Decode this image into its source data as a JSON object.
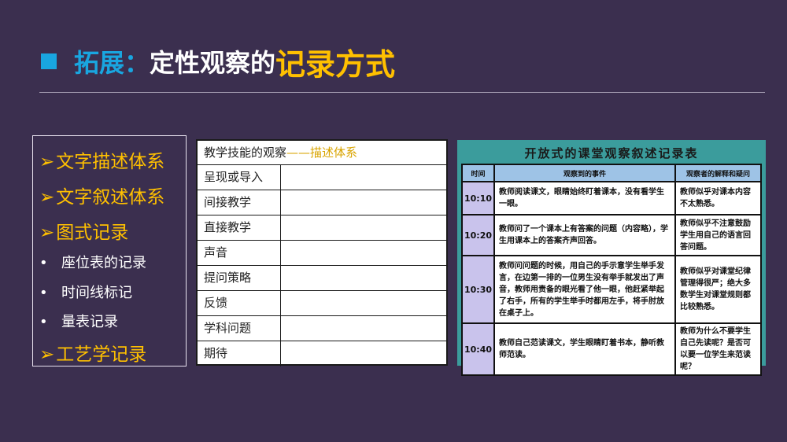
{
  "title": {
    "prefix": "拓展：",
    "main": "定性观察的",
    "accent": "记录方式"
  },
  "left_list": {
    "items": [
      {
        "kind": "major",
        "marker": "➢",
        "label": "文字描述体系"
      },
      {
        "kind": "major",
        "marker": "➢",
        "label": "文字叙述体系"
      },
      {
        "kind": "major",
        "marker": "➢",
        "label": "图式记录"
      },
      {
        "kind": "minor",
        "marker": "•",
        "label": "座位表的记录"
      },
      {
        "kind": "minor",
        "marker": "•",
        "label": "时间线标记"
      },
      {
        "kind": "minor",
        "marker": "•",
        "label": "量表记录"
      },
      {
        "kind": "major",
        "marker": "➢",
        "label": "工艺学记录"
      }
    ]
  },
  "mid_table": {
    "header_prefix": "教学技能的观察",
    "header_highlight": "——描述体系",
    "rows": [
      "呈现或导入",
      "间接教学",
      "直接教学",
      "声音",
      "提问策略",
      "反馈",
      "学科问题",
      "期待"
    ]
  },
  "record_table": {
    "title": "开放式的课堂观察叙述记录表",
    "columns": [
      "时间",
      "观察到的事件",
      "观察者的解释和疑问"
    ],
    "rows": [
      {
        "time": "10:10",
        "event": "教师阅读课文，眼睛始终盯着课本，没有看学生一眼。",
        "note": "教师似乎对课本内容不太熟悉。"
      },
      {
        "time": "10:20",
        "event": "教师问了一个课本上有答案的问题（内容略），学生用课本上的答案齐声回答。",
        "note": "教师似乎不注意鼓励学生用自己的语言回答问题。"
      },
      {
        "time": "10:30",
        "event": "教师问问题的时候，用自己的手示意学生举手发言，在边第一排的一位男生没有举手就发出了声音，教师用责备的眼光看了他一眼，他赶紧举起了右手，所有的学生举手时都用左手，将手肘放在桌子上。",
        "note": "教师似乎对课堂纪律管理得很严；绝大多数学生对课堂规则都比较熟悉。"
      },
      {
        "time": "10:40",
        "event": "教师自己范读课文，学生眼睛盯着书本，静听教师范读。",
        "note": "教师为什么不要学生自己先读呢？是否可以要一位学生来范读呢？"
      }
    ]
  },
  "colors": {
    "background": "#3b2f4f",
    "title_prefix": "#19a6e0",
    "accent": "#ffc000",
    "record_frame": "#3b9c9c",
    "record_header": "#9ec3e6",
    "record_time": "#c9c3ec"
  }
}
